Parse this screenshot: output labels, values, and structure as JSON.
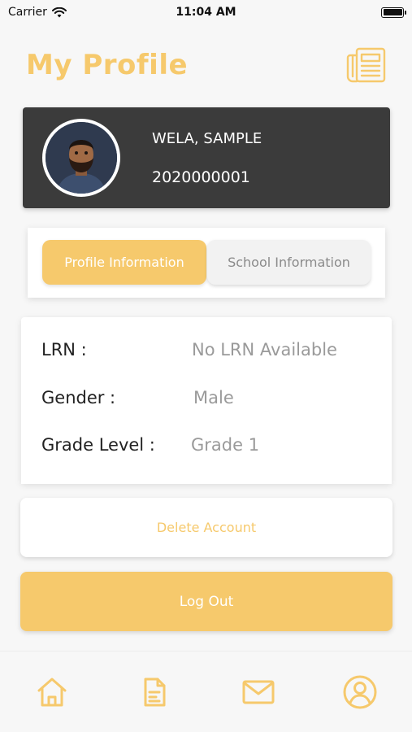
{
  "status_bar": {
    "carrier": "Carrier",
    "time": "11:04 AM",
    "icons": [
      "wifi-icon",
      "battery-icon"
    ]
  },
  "header": {
    "title": "My Profile",
    "icon": "newspaper-icon"
  },
  "profile": {
    "name": "WELA, SAMPLE",
    "id_number": "2020000001",
    "avatar_icon": "avatar"
  },
  "tabs": [
    {
      "label": "Profile Information",
      "active": true
    },
    {
      "label": "School Information",
      "active": false
    }
  ],
  "info": {
    "rows": [
      {
        "label": "LRN :",
        "value": "No LRN Available"
      },
      {
        "label": "Gender :",
        "value": "Male"
      },
      {
        "label": "Grade Level :",
        "value": "Grade 1"
      }
    ]
  },
  "actions": {
    "delete_label": "Delete Account",
    "logout_label": "Log Out"
  },
  "bottom_nav": {
    "items": [
      "home-icon",
      "document-icon",
      "mail-icon",
      "profile-icon"
    ]
  },
  "colors": {
    "accent": "#f6c96c",
    "card_dark": "#3b3b3b",
    "background": "#f7f7f7"
  }
}
